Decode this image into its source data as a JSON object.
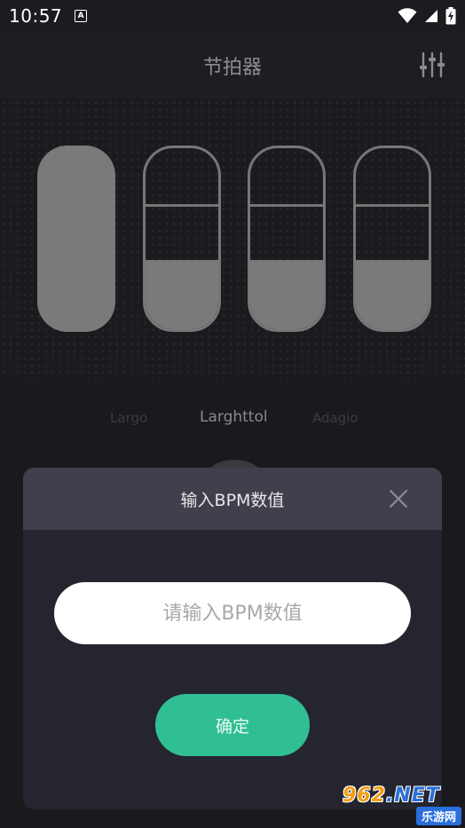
{
  "status_bar": {
    "time": "10:57",
    "notification_letter": "A",
    "icons": [
      "wifi-icon",
      "signal-icon",
      "battery-charging-icon"
    ]
  },
  "app_bar": {
    "title": "节拍器",
    "settings_icon": "mixer-sliders-icon"
  },
  "beats": [
    {
      "type": "accent"
    },
    {
      "type": "normal"
    },
    {
      "type": "normal"
    },
    {
      "type": "normal"
    }
  ],
  "tempo_names": {
    "previous": "Largo",
    "current": "Larghttol",
    "next": "Adagio"
  },
  "dialog": {
    "title": "输入BPM数值",
    "close_icon": "close-icon",
    "input_value": "",
    "input_placeholder": "请输入BPM数值",
    "confirm_label": "确定"
  },
  "watermark": {
    "brand": "962",
    "tld": ".NET",
    "subtitle": "乐游网"
  },
  "colors": {
    "accent_green": "#30bf93",
    "background": "#1a1a1e",
    "dialog_header": "#3f404b",
    "dialog_body": "#25252f",
    "beat_fill": "#7a7a7a"
  }
}
